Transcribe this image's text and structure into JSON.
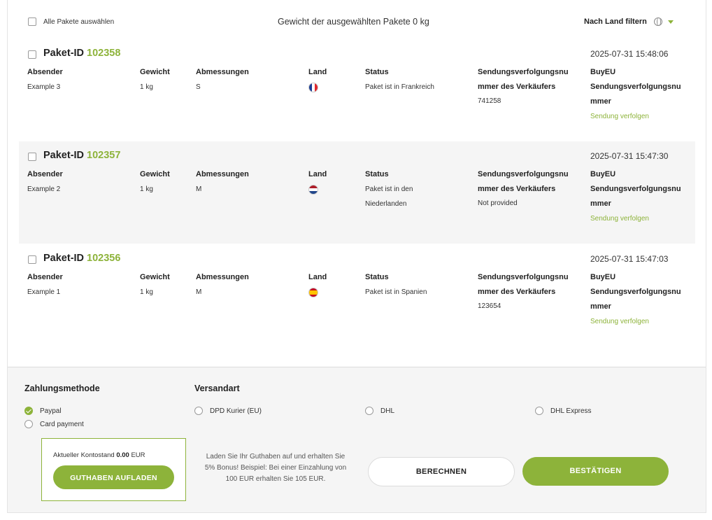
{
  "header": {
    "select_all_label": "Alle Pakete auswählen",
    "selected_weight_text": "Gewicht der ausgewählten Pakete 0 kg",
    "filter_label": "Nach Land filtern"
  },
  "columns": {
    "sender": "Absender",
    "weight": "Gewicht",
    "dimensions": "Abmessungen",
    "country": "Land",
    "status": "Status",
    "seller_tracking": [
      "Sendungsverfolgungsnu",
      "mmer des Verkäufers"
    ],
    "buyeu_tracking": [
      "BuyEU",
      "Sendungsverfolgungsnu",
      "mmer"
    ]
  },
  "packages": [
    {
      "id_label": "Paket-ID",
      "id": "102358",
      "datetime": "2025-07-31 15:48:06",
      "sender": "Example 3",
      "weight": "1 kg",
      "dimensions": "S",
      "country_flag": "france-flag",
      "status_lines": [
        "Paket ist in Frankreich"
      ],
      "seller_tracking": "741258",
      "track_link": "Sendung verfolgen"
    },
    {
      "id_label": "Paket-ID",
      "id": "102357",
      "datetime": "2025-07-31 15:47:30",
      "sender": "Example 2",
      "weight": "1 kg",
      "dimensions": "M",
      "country_flag": "netherlands-flag",
      "status_lines": [
        "Paket ist in den",
        "Niederlanden"
      ],
      "seller_tracking": "Not provided",
      "track_link": "Sendung verfolgen"
    },
    {
      "id_label": "Paket-ID",
      "id": "102356",
      "datetime": "2025-07-31 15:47:03",
      "sender": "Example 1",
      "weight": "1 kg",
      "dimensions": "M",
      "country_flag": "spain-flag",
      "status_lines": [
        "Paket ist in Spanien"
      ],
      "seller_tracking": "123654",
      "track_link": "Sendung verfolgen"
    }
  ],
  "payment": {
    "title": "Zahlungsmethode",
    "options": [
      {
        "label": "Paypal",
        "selected": true
      },
      {
        "label": "Card payment",
        "selected": false
      }
    ]
  },
  "shipping": {
    "title": "Versandart",
    "options": [
      {
        "label": "DPD Kurier (EU)",
        "selected": false
      },
      {
        "label": "DHL",
        "selected": false
      },
      {
        "label": "DHL Express",
        "selected": false
      }
    ]
  },
  "balance": {
    "label": "Aktueller Kontostand",
    "amount": "0.00",
    "currency": "EUR",
    "topup_button": "GUTHABEN AUFLADEN"
  },
  "bonus_text": "Laden Sie Ihr Guthaben auf und erhalten Sie 5% Bonus! Beispiel: Bei einer Einzahlung von 100 EUR erhalten Sie 105 EUR.",
  "actions": {
    "calculate": "BERECHNEN",
    "confirm": "BESTÄTIGEN"
  },
  "colors": {
    "accent": "#8db33a",
    "shaded_row": "#f5f5f5"
  }
}
